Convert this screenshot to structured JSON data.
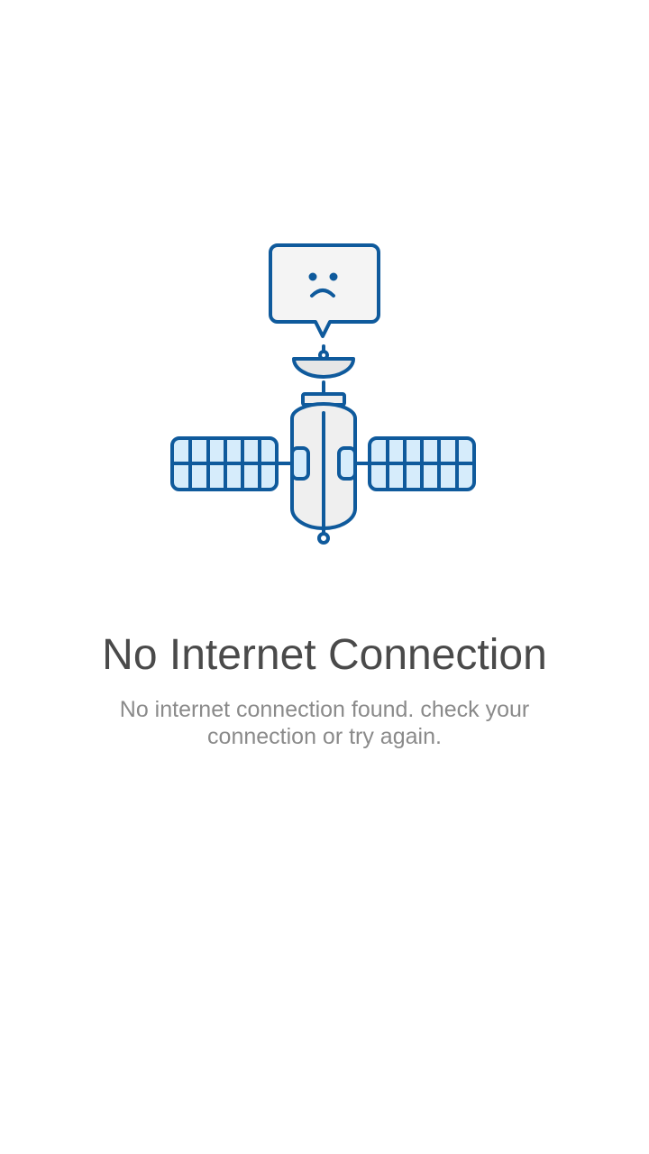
{
  "screen": {
    "title": "No Internet Connection",
    "message": "No internet connection found. check your connection or try again."
  },
  "illustration": {
    "icon": "satellite-sad-icon",
    "colors": {
      "stroke": "#0f5a9c",
      "panel_fill": "#d6ecfb",
      "body_fill": "#efefef",
      "bubble_fill": "#f4f4f4"
    }
  }
}
